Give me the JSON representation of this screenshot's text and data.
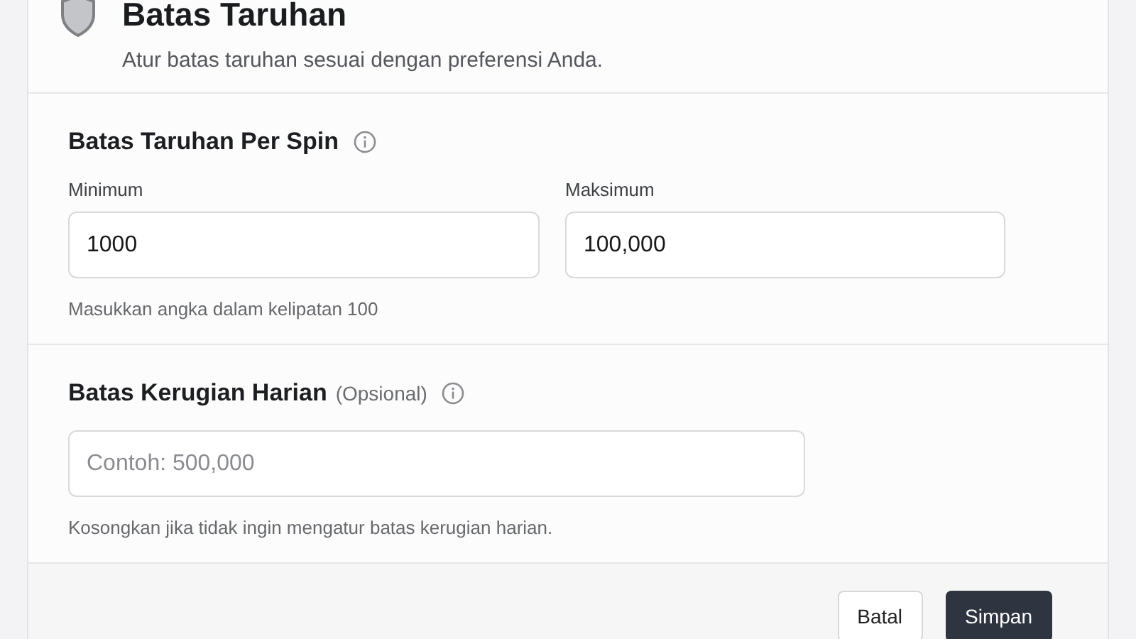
{
  "header": {
    "title": "Batas Taruhan",
    "subtitle": "Atur batas taruhan sesuai dengan preferensi Anda."
  },
  "bet_limit": {
    "title": "Batas Taruhan Per Spin",
    "fields": [
      {
        "label": "Minimum",
        "value": "1000"
      },
      {
        "label": "Maksimum",
        "value": "100,000"
      }
    ],
    "help": "Masukkan angka dalam kelipatan 100"
  },
  "daily_loss": {
    "title": "Batas Kerugian Harian",
    "note": "(Opsional)",
    "placeholder": "Contoh: 500,000",
    "help": "Kosongkan jika tidak ingin mengatur batas kerugian harian."
  },
  "buttons": [
    {
      "label": "Batal",
      "kind": "secondary"
    },
    {
      "label": "Simpan",
      "kind": "primary"
    }
  ]
}
